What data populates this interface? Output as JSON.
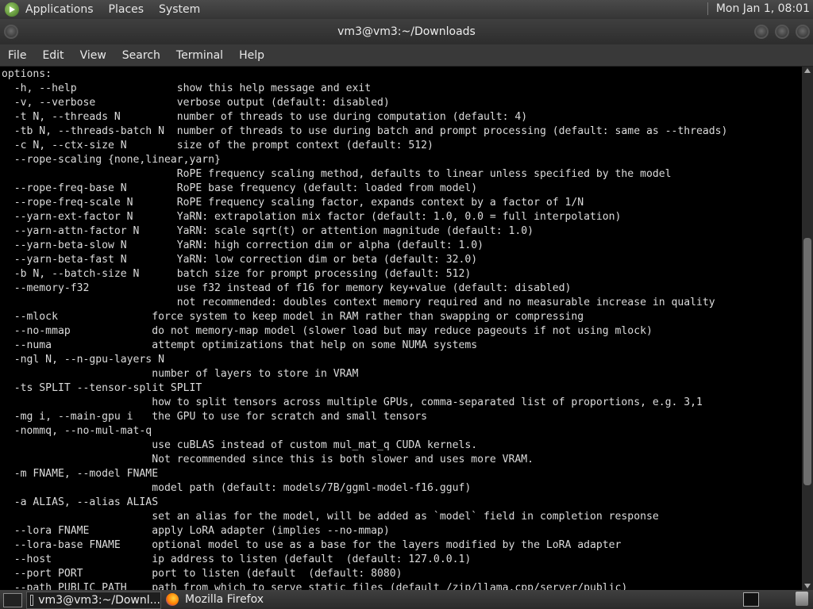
{
  "top_panel": {
    "menus": [
      "Applications",
      "Places",
      "System"
    ],
    "clock": "Mon Jan 1, 08:01"
  },
  "window": {
    "title": "vm3@vm3:~/Downloads",
    "menus": [
      "File",
      "Edit",
      "View",
      "Search",
      "Terminal",
      "Help"
    ]
  },
  "terminal": {
    "lines": [
      "options:",
      "  -h, --help                show this help message and exit",
      "  -v, --verbose             verbose output (default: disabled)",
      "  -t N, --threads N         number of threads to use during computation (default: 4)",
      "  -tb N, --threads-batch N  number of threads to use during batch and prompt processing (default: same as --threads)",
      "  -c N, --ctx-size N        size of the prompt context (default: 512)",
      "  --rope-scaling {none,linear,yarn}",
      "                            RoPE frequency scaling method, defaults to linear unless specified by the model",
      "  --rope-freq-base N        RoPE base frequency (default: loaded from model)",
      "  --rope-freq-scale N       RoPE frequency scaling factor, expands context by a factor of 1/N",
      "  --yarn-ext-factor N       YaRN: extrapolation mix factor (default: 1.0, 0.0 = full interpolation)",
      "  --yarn-attn-factor N      YaRN: scale sqrt(t) or attention magnitude (default: 1.0)",
      "  --yarn-beta-slow N        YaRN: high correction dim or alpha (default: 1.0)",
      "  --yarn-beta-fast N        YaRN: low correction dim or beta (default: 32.0)",
      "  -b N, --batch-size N      batch size for prompt processing (default: 512)",
      "  --memory-f32              use f32 instead of f16 for memory key+value (default: disabled)",
      "                            not recommended: doubles context memory required and no measurable increase in quality",
      "  --mlock               force system to keep model in RAM rather than swapping or compressing",
      "  --no-mmap             do not memory-map model (slower load but may reduce pageouts if not using mlock)",
      "  --numa                attempt optimizations that help on some NUMA systems",
      "  -ngl N, --n-gpu-layers N",
      "                        number of layers to store in VRAM",
      "  -ts SPLIT --tensor-split SPLIT",
      "                        how to split tensors across multiple GPUs, comma-separated list of proportions, e.g. 3,1",
      "  -mg i, --main-gpu i   the GPU to use for scratch and small tensors",
      "  -nommq, --no-mul-mat-q",
      "                        use cuBLAS instead of custom mul_mat_q CUDA kernels.",
      "                        Not recommended since this is both slower and uses more VRAM.",
      "  -m FNAME, --model FNAME",
      "                        model path (default: models/7B/ggml-model-f16.gguf)",
      "  -a ALIAS, --alias ALIAS",
      "                        set an alias for the model, will be added as `model` field in completion response",
      "  --lora FNAME          apply LoRA adapter (implies --no-mmap)",
      "  --lora-base FNAME     optional model to use as a base for the layers modified by the LoRA adapter",
      "  --host                ip address to listen (default  (default: 127.0.0.1)",
      "  --port PORT           port to listen (default  (default: 8080)",
      "  --path PUBLIC_PATH    path from which to serve static files (default /zip/llama.cpp/server/public)"
    ]
  },
  "taskbar": {
    "items": [
      "vm3@vm3:~/Downl...",
      "Mozilla Firefox"
    ]
  }
}
